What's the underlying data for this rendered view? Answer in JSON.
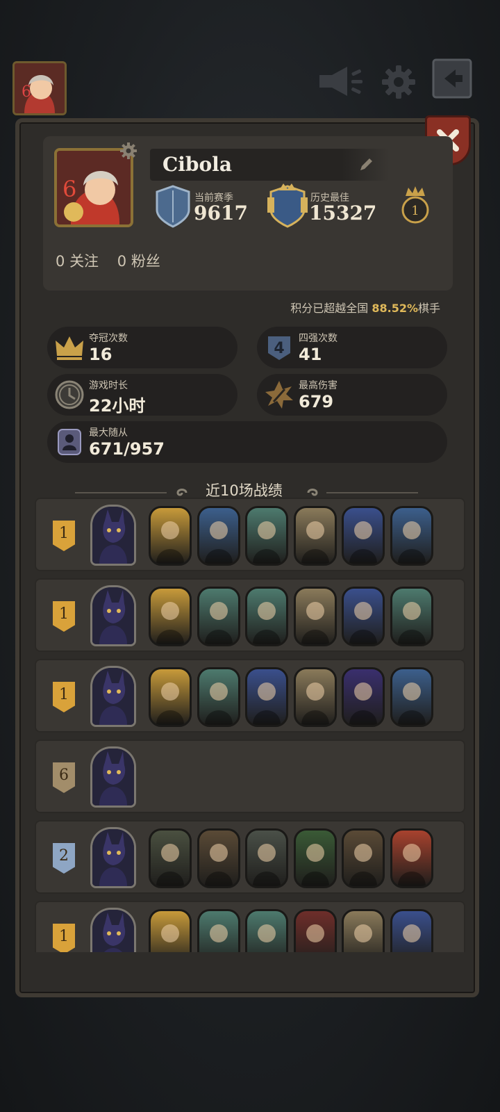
{
  "top_bar": {
    "avatar_level": "6",
    "icons": [
      "megaphone-icon",
      "gear-icon",
      "back-arrow-icon"
    ]
  },
  "profile": {
    "avatar_level": "6",
    "name": "Cibola",
    "current_season_label": "当前赛季",
    "current_season_value": "9617",
    "best_label": "历史最佳",
    "best_value": "15327",
    "crown_rank": "1",
    "following_count": "0",
    "following_label": "关注",
    "followers_count": "0",
    "followers_label": "粉丝"
  },
  "percentile": {
    "prefix": "积分已超越全国",
    "value": "88.52%",
    "suffix": "棋手"
  },
  "stats": {
    "champions_label": "夺冠次数",
    "champions_value": "16",
    "top4_label": "四强次数",
    "top4_value": "41",
    "playtime_label": "游戏时长",
    "playtime_value": "22小时",
    "max_damage_label": "最高伤害",
    "max_damage_value": "679",
    "max_followers_label": "最大随从",
    "max_followers_value": "671/957"
  },
  "recent_title": "近10场战绩",
  "matches": [
    {
      "rank": "1",
      "rank_color": "#d9a23a",
      "hero": "dark-wolf-hero",
      "units": [
        "#c79a3a",
        "#3c5f8c",
        "#4d7a6e",
        "#8a7a5a",
        "#3a4f8c",
        "#3c5f8c"
      ]
    },
    {
      "rank": "1",
      "rank_color": "#d9a23a",
      "hero": "dark-wolf-hero",
      "units": [
        "#c79a3a",
        "#4d7a6e",
        "#4d7a6e",
        "#8a7a5a",
        "#3a4f8c",
        "#4d7a6e"
      ]
    },
    {
      "rank": "1",
      "rank_color": "#d9a23a",
      "hero": "black-cat-hero",
      "units": [
        "#c79a3a",
        "#4d7a6e",
        "#3a4f8c",
        "#8a7a5a",
        "#3a2f6e",
        "#3c5f8c"
      ]
    },
    {
      "rank": "6",
      "rank_color": "#a28d6a",
      "hero": "tabby-cat-hero",
      "units": []
    },
    {
      "rank": "2",
      "rank_color": "#8ea6c4",
      "hero": "moon-warrior-hero",
      "units": [
        "#4a5040",
        "#5a4a36",
        "#4a5048",
        "#3a5a36",
        "#5a4a36",
        "#a8422e"
      ]
    },
    {
      "rank": "1",
      "rank_color": "#d9a23a",
      "hero": "dark-wolf-hero",
      "units": [
        "#c79a3a",
        "#4d7a6e",
        "#4d7a6e",
        "#6e2e2a",
        "#8a7a5a",
        "#3a4f8c"
      ]
    }
  ]
}
